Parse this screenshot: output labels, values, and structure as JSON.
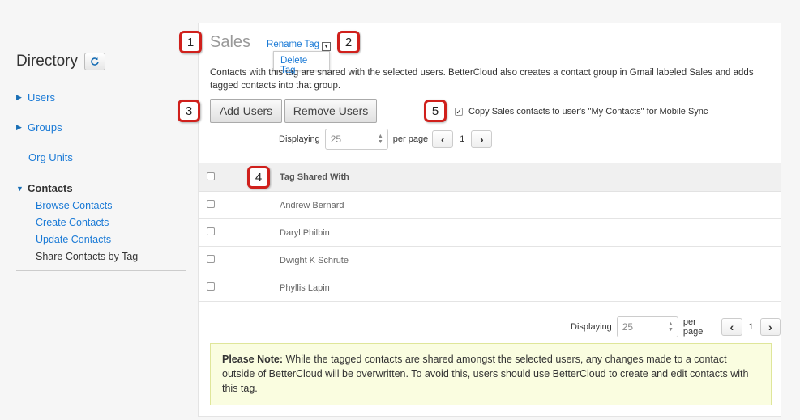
{
  "sidebar": {
    "title": "Directory",
    "refresh_icon": "refresh-icon",
    "sections": [
      {
        "label": "Users"
      },
      {
        "label": "Groups"
      },
      {
        "label": "Org Units"
      }
    ],
    "contacts": {
      "label": "Contacts",
      "items": [
        {
          "label": "Browse Contacts"
        },
        {
          "label": "Create Contacts"
        },
        {
          "label": "Update Contacts"
        },
        {
          "label": "Share Contacts by Tag"
        }
      ]
    }
  },
  "main": {
    "title": "Sales",
    "rename_tag": "Rename Tag",
    "menu_item": "Delete Tag",
    "description": "Contacts with this tag are shared with the selected users. BetterCloud also creates a contact group in Gmail labeled Sales and adds tagged contacts into that group.",
    "add_users": "Add Users",
    "remove_users": "Remove Users",
    "copy_label": "Copy Sales contacts to user's \"My Contacts\" for Mobile Sync",
    "displaying": "Displaying",
    "per_page_value": "25",
    "per_page": "per page",
    "page": "1",
    "table_header": "Tag Shared With",
    "rows": [
      {
        "name": "Andrew Bernard"
      },
      {
        "name": "Daryl Philbin"
      },
      {
        "name": "Dwight K Schrute"
      },
      {
        "name": "Phyllis Lapin"
      }
    ],
    "note_label": "Please Note:",
    "note_text": " While the tagged contacts are shared amongst the selected users, any changes made to a contact outside of BetterCloud will be overwritten. To avoid this, users should use BetterCloud to create and edit contacts with this tag."
  },
  "callouts": [
    "1",
    "2",
    "3",
    "4",
    "5"
  ],
  "colors": {
    "link": "#1a7ad6",
    "callout_border": "#d0201c",
    "note_bg": "#fafde0"
  }
}
